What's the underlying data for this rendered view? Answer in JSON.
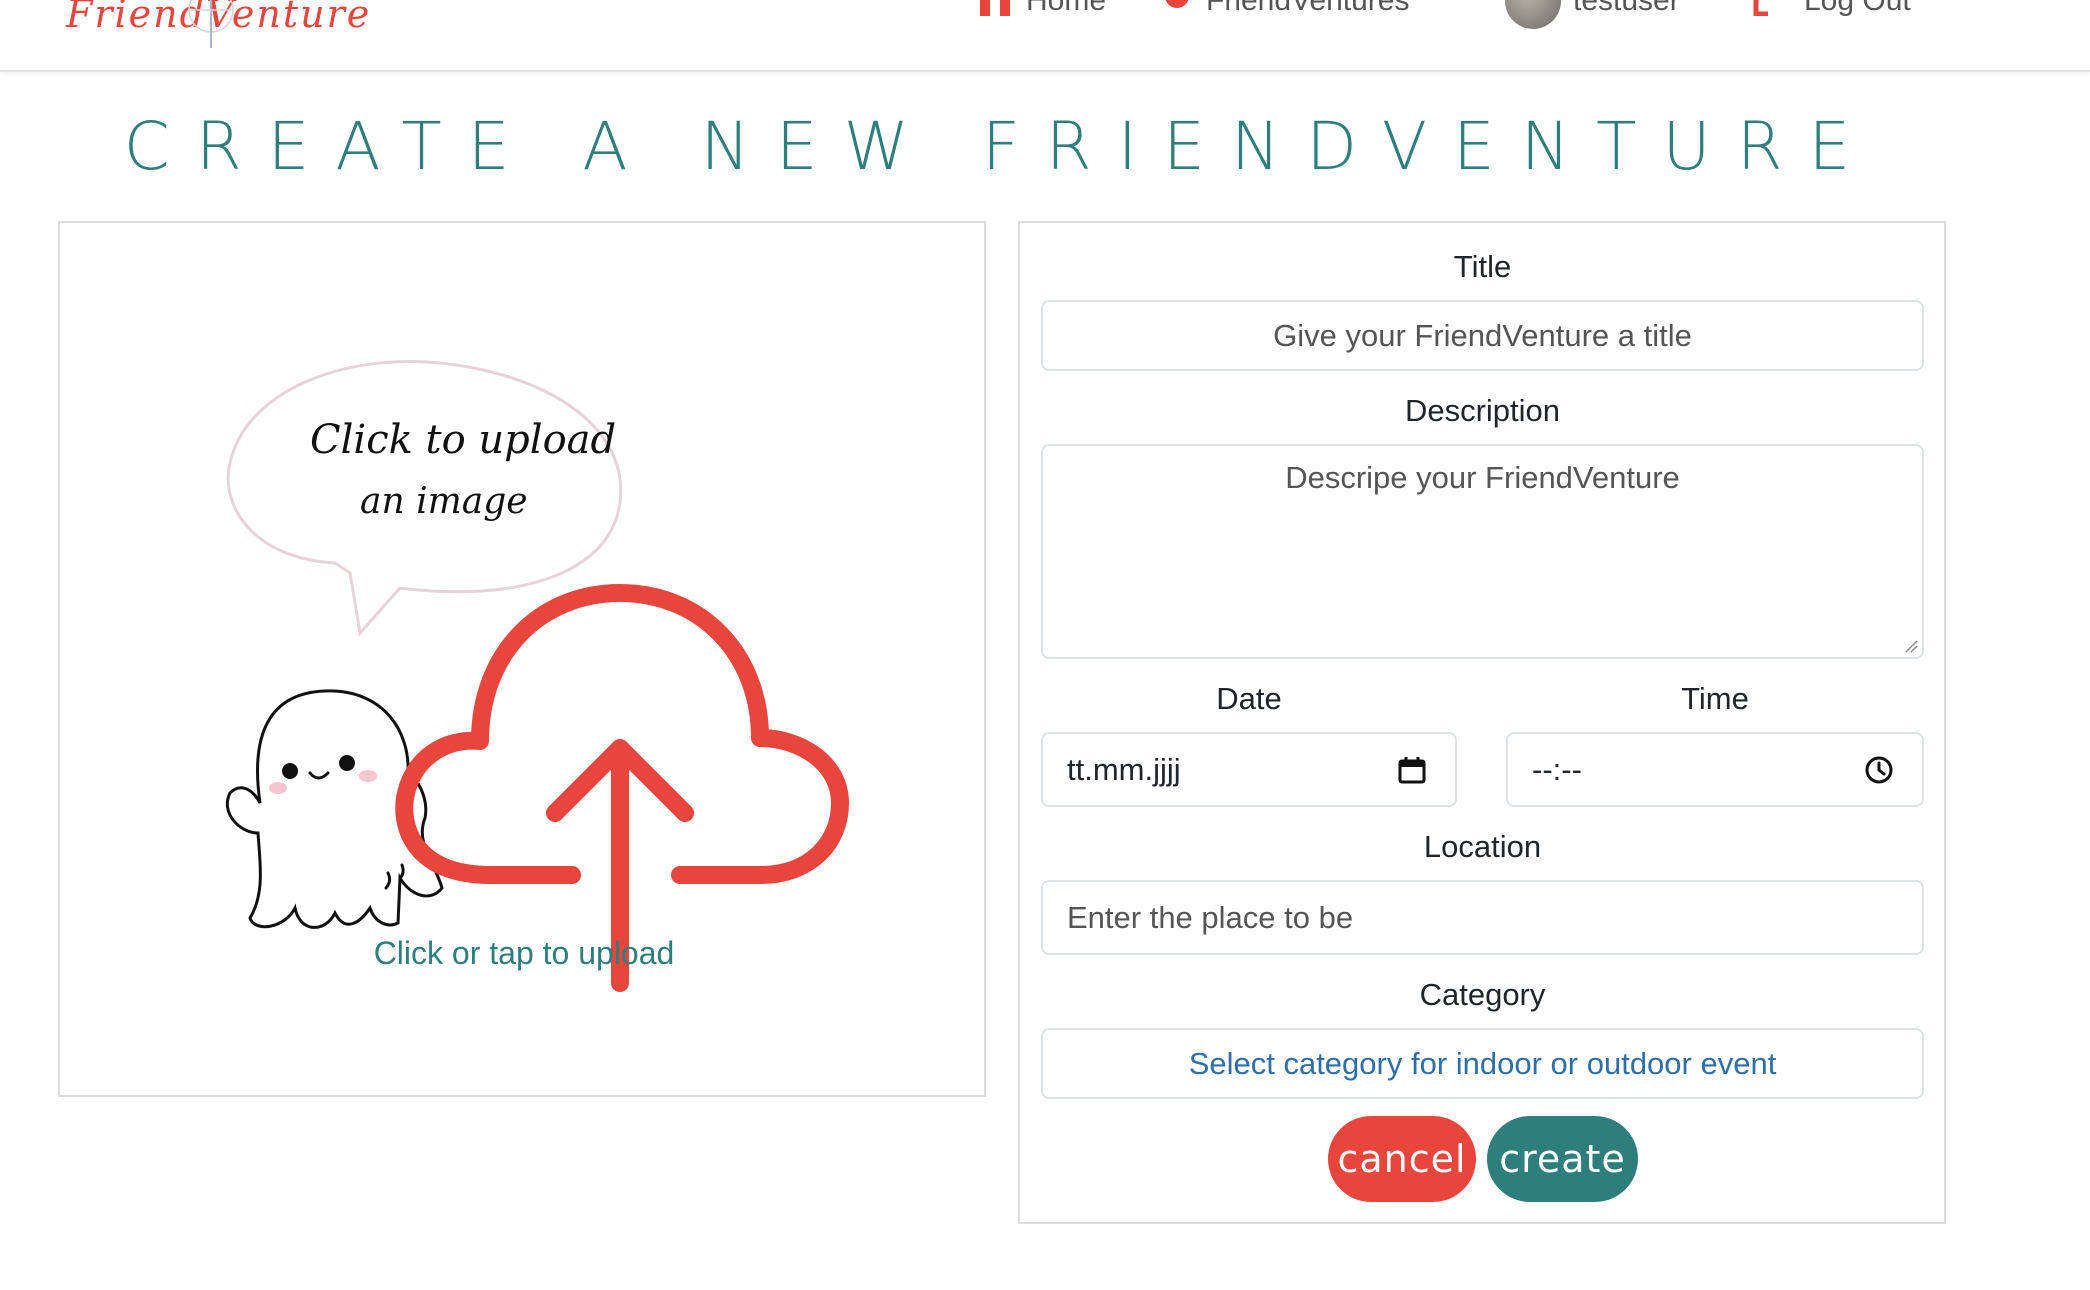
{
  "header": {
    "brand_text": "FriendVenture",
    "nav": {
      "home": "Home",
      "friendventures": "FriendVentures",
      "user": "testuser",
      "logout": "Log Out"
    }
  },
  "page": {
    "title": "CREATE A NEW FRIENDVENTURE"
  },
  "upload": {
    "bubble_line1": "Click to upload",
    "bubble_line2": "an image",
    "hint": "Click or tap to upload"
  },
  "form": {
    "title_label": "Title",
    "title_placeholder": "Give your FriendVenture a title",
    "description_label": "Description",
    "description_placeholder": "Descripe your FriendVenture",
    "date_label": "Date",
    "date_value": "tt.mm.jjjj",
    "time_label": "Time",
    "time_value": "--:--",
    "location_label": "Location",
    "location_placeholder": "Enter the place to be",
    "category_label": "Category",
    "category_selected": "Select category for indoor or outdoor event",
    "cancel_label": "cancel",
    "create_label": "create"
  },
  "colors": {
    "accent_red": "#e8453c",
    "accent_teal": "#2e7f7b",
    "select_blue": "#2f6fa8"
  },
  "icons": {
    "home": "home-icon",
    "friendventures": "compass-icon",
    "logout": "logout-icon",
    "date": "calendar-icon",
    "time": "clock-icon",
    "upload": "cloud-upload-icon"
  }
}
